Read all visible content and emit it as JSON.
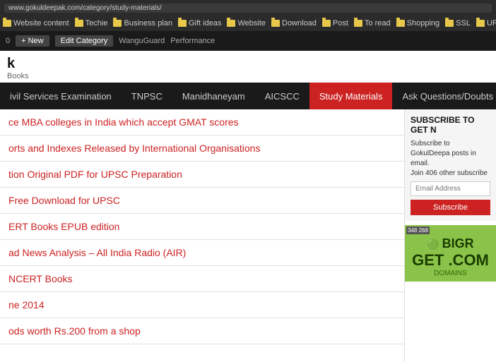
{
  "browser": {
    "url": "www.gokuldeepak.com/category/study-materials/",
    "bookmarks": [
      {
        "label": "Website content"
      },
      {
        "label": "Techie"
      },
      {
        "label": "Business plan"
      },
      {
        "label": "Gift ideas"
      },
      {
        "label": "Website"
      },
      {
        "label": "Download"
      },
      {
        "label": "Post"
      },
      {
        "label": "To read"
      },
      {
        "label": "Shopping"
      },
      {
        "label": "SSL"
      },
      {
        "label": "UPSC"
      }
    ]
  },
  "toolbar": {
    "counter": "0",
    "new_label": "+ New",
    "edit_label": "Edit Category",
    "wanguard_label": "WanguGuard",
    "performance_label": "Performance"
  },
  "site": {
    "title": "k",
    "subtitle": "Books"
  },
  "nav": {
    "items": [
      {
        "label": "ivil Services Examination",
        "active": false
      },
      {
        "label": "TNPSC",
        "active": false
      },
      {
        "label": "Manidhaneyam",
        "active": false
      },
      {
        "label": "AICSCC",
        "active": false
      },
      {
        "label": "Study Materials",
        "active": true
      },
      {
        "label": "Ask Questions/Doubts",
        "active": false
      }
    ]
  },
  "content": {
    "articles": [
      {
        "text": "ce MBA colleges in India which accept GMAT scores"
      },
      {
        "text": "orts and Indexes Released by International Organisations"
      },
      {
        "text": "tion Original PDF for UPSC Preparation"
      },
      {
        "text": "Free Download for UPSC"
      },
      {
        "text": "ERT Books EPUB edition"
      },
      {
        "text": "ad News Analysis – All India Radio (AIR)"
      },
      {
        "text": "NCERT Books"
      },
      {
        "text": "ne 2014"
      },
      {
        "text": "ods worth Rs.200 from a shop"
      }
    ]
  },
  "sidebar": {
    "subscribe_heading": "SUBSCRIBE TO GET N",
    "subscribe_text": "Subscribe to GokulDeepa posts in email.",
    "subscriber_count": "Join 406 other subscribe",
    "email_placeholder": "Email Address",
    "subscribe_btn": "Subscribe",
    "ad": {
      "label": "348 268",
      "brand": "BIGR",
      "tagline": "GET .COM",
      "sub": "DOMAINS"
    }
  }
}
